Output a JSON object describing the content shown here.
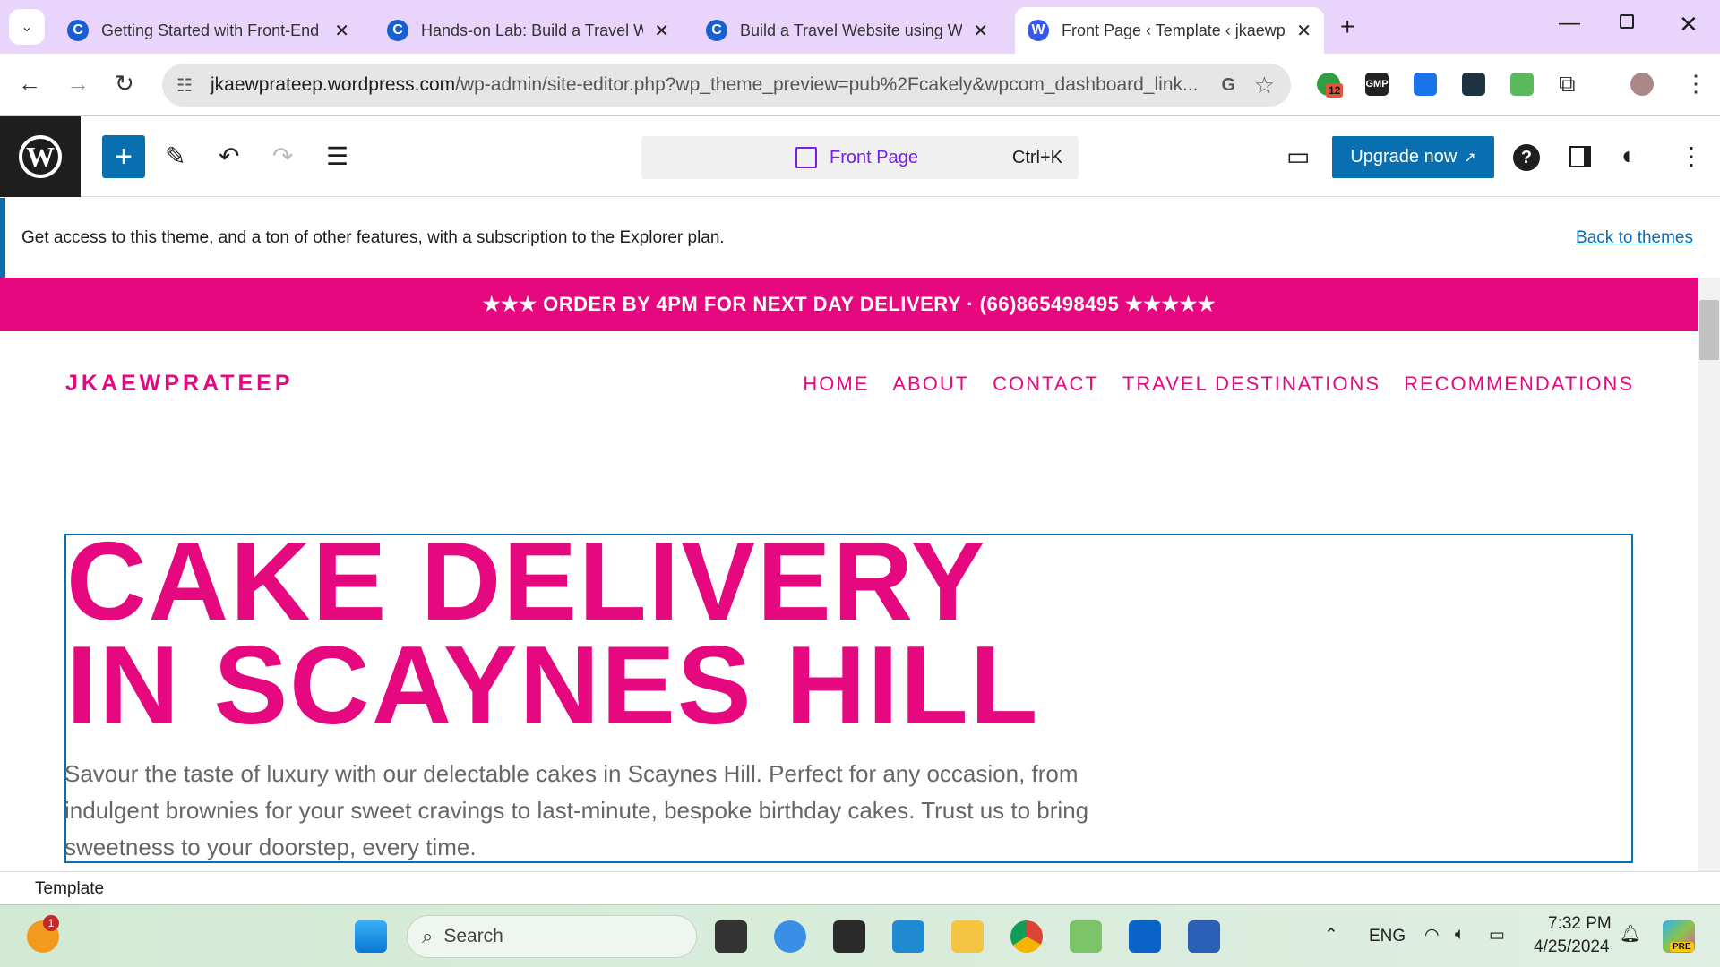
{
  "browser": {
    "tabs": [
      {
        "title": "Getting Started with Front-End and Web Development",
        "icon": "coursera-icon",
        "active": false
      },
      {
        "title": "Hands-on Lab: Build a Travel Website",
        "icon": "coursera-icon",
        "active": false
      },
      {
        "title": "Build a Travel Website using WordPress",
        "icon": "coursera-icon",
        "active": false
      },
      {
        "title": "Front Page ‹ Template ‹ jkaewprateep",
        "icon": "wordpress-icon",
        "active": true
      }
    ],
    "url_host": "jkaewprateep.wordpress.com",
    "url_path": "/wp-admin/site-editor.php?wp_theme_preview=pub%2Fcakely&wpcom_dashboard_link...",
    "extension_badge": "12",
    "gmp_label": "GMP"
  },
  "editor": {
    "document_title": "Front Page",
    "shortcut": "Ctrl+K",
    "upgrade_label": "Upgrade now",
    "notice": "Get access to this theme, and a ton of other features, with a subscription to the Explorer plan.",
    "back_link": "Back to themes",
    "footer_label": "Template"
  },
  "site": {
    "banner": "★★★ ORDER BY 4PM FOR NEXT DAY DELIVERY · (66)865498495 ★★★★★",
    "logo": "JKAEWPRATEEP",
    "menu": [
      "HOME",
      "ABOUT",
      "CONTACT",
      "TRAVEL DESTINATIONS",
      "RECOMMENDATIONS"
    ],
    "hero_line1": "CAKE DELIVERY",
    "hero_line2": "IN SCAYNES HILL",
    "hero_text": "Savour the taste of luxury with our delectable cakes in Scaynes Hill. Perfect for any occasion, from indulgent brownies for your sweet cravings to last-minute, bespoke birthday cakes. Trust us to bring sweetness to your doorstep, every time.",
    "accent": "#e5087f"
  },
  "taskbar": {
    "search_placeholder": "Search",
    "weather_badge": "1",
    "lang": "ENG",
    "time": "7:32 PM",
    "date": "4/25/2024",
    "copilot_badge": "PRE"
  }
}
